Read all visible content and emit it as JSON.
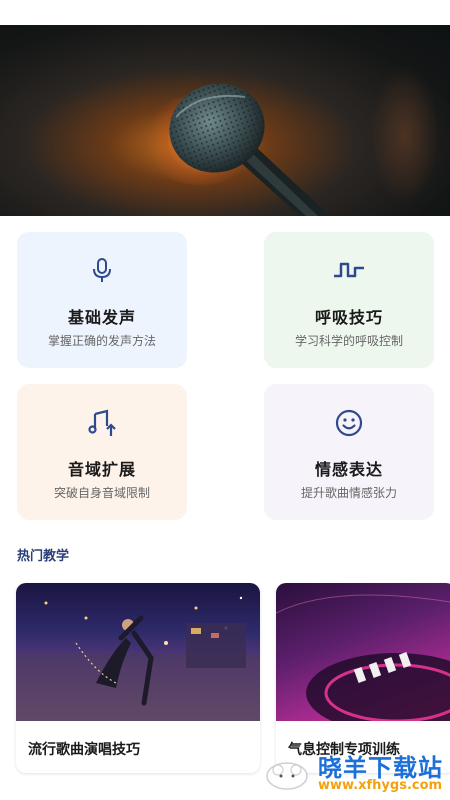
{
  "hero": {
    "image": "microphone-photo"
  },
  "features": [
    {
      "title": "基础发声",
      "desc": "掌握正确的发声方法",
      "icon": "microphone-icon"
    },
    {
      "title": "呼吸技巧",
      "desc": "学习科学的呼吸控制",
      "icon": "breath-wave-icon"
    },
    {
      "title": "音域扩展",
      "desc": "突破自身音域限制",
      "icon": "music-note-up-icon"
    },
    {
      "title": "情感表达",
      "desc": "提升歌曲情感张力",
      "icon": "smiley-face-icon"
    }
  ],
  "hot_section": {
    "title": "热门教学"
  },
  "lessons": [
    {
      "title": "流行歌曲演唱技巧",
      "image": "dancer-night-street-photo"
    },
    {
      "title": "气息控制专项训练",
      "image": "dj-turntable-photo"
    }
  ],
  "watermark": {
    "brand": "晓羊下载站",
    "url": "www.xfhygs.com"
  },
  "colors": {
    "accent": "#2a3e7c",
    "icon": "#2e4a8c",
    "watermark_blue": "#1b6fd8",
    "watermark_orange": "#f2a10f"
  }
}
